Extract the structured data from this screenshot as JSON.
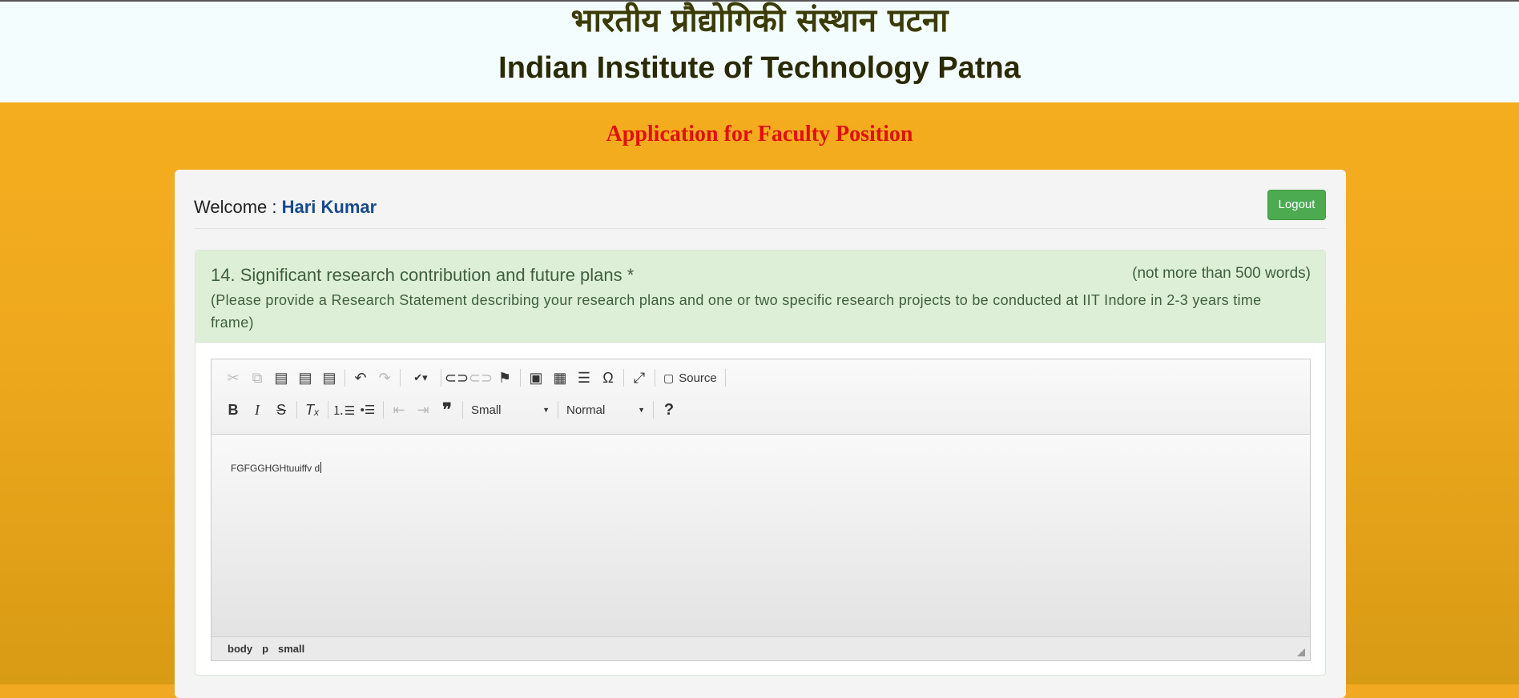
{
  "header": {
    "hindi_title": "भारतीय प्रौद्योगिकी संस्थान पटना",
    "english_title": "Indian Institute of Technology Patna"
  },
  "page_title": "Application for Faculty Position",
  "welcome": {
    "label": "Welcome : ",
    "user_name": "Hari Kumar",
    "logout_label": "Logout"
  },
  "question": {
    "title": "14. Significant research contribution and future plans *",
    "word_limit": "(not more than 500 words)",
    "description": "(Please provide a Research Statement describing your research plans and one or two specific research projects to be conducted at IIT Indore in 2-3 years time frame)"
  },
  "editor": {
    "toolbar_row1": [
      {
        "icon": "cut-icon",
        "glyph": "✂",
        "enabled": false
      },
      {
        "icon": "copy-icon",
        "glyph": "⧉",
        "enabled": false
      },
      {
        "icon": "paste-icon",
        "glyph": "📋",
        "enabled": true
      },
      {
        "icon": "paste-text-icon",
        "glyph": "📋",
        "enabled": true
      },
      {
        "icon": "paste-word-icon",
        "glyph": "📋",
        "enabled": true
      },
      {
        "icon": "undo-icon",
        "glyph": "↶",
        "enabled": true
      },
      {
        "icon": "redo-icon",
        "glyph": "↷",
        "enabled": false
      },
      {
        "icon": "spellcheck-icon",
        "glyph": "✔",
        "enabled": true
      },
      {
        "icon": "link-icon",
        "glyph": "🔗",
        "enabled": true
      },
      {
        "icon": "unlink-icon",
        "glyph": "⛓",
        "enabled": false
      },
      {
        "icon": "anchor-icon",
        "glyph": "⚑",
        "enabled": true
      },
      {
        "icon": "image-icon",
        "glyph": "🖼",
        "enabled": true
      },
      {
        "icon": "table-icon",
        "glyph": "▦",
        "enabled": true
      },
      {
        "icon": "horizontal-line-icon",
        "glyph": "☰",
        "enabled": true
      },
      {
        "icon": "special-char-icon",
        "glyph": "Ω",
        "enabled": true
      },
      {
        "icon": "maximize-icon",
        "glyph": "⤢",
        "enabled": true
      }
    ],
    "source_label": "Source",
    "font_size_value": "Small",
    "format_value": "Normal",
    "content_text": "FGFGGHGHtuuiffv d",
    "path": [
      "body",
      "p",
      "small"
    ]
  }
}
